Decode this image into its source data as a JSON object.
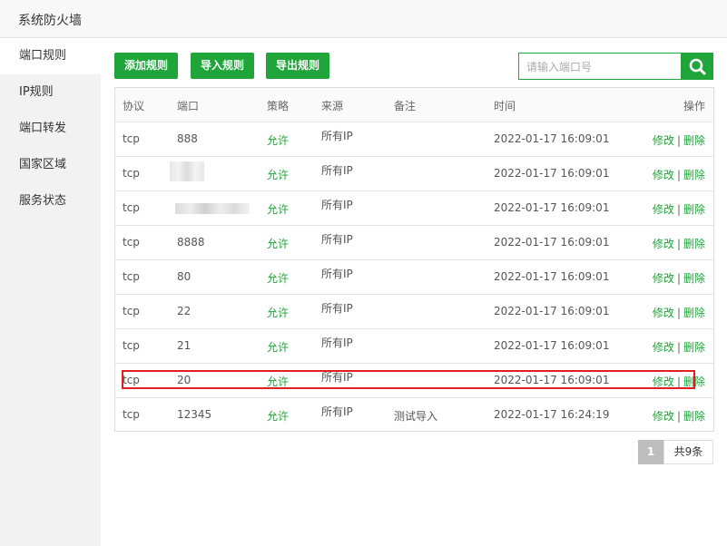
{
  "window": {
    "title": "系统防火墙"
  },
  "sidebar": {
    "items": [
      {
        "label": "端口规则"
      },
      {
        "label": "IP规则"
      },
      {
        "label": "端口转发"
      },
      {
        "label": "国家区域"
      },
      {
        "label": "服务状态"
      }
    ]
  },
  "toolbar": {
    "add_label": "添加规则",
    "import_label": "导入规则",
    "export_label": "导出规则",
    "search_placeholder": "请输入端口号",
    "search_icon": "search-icon"
  },
  "table": {
    "headers": [
      "协议",
      "端口",
      "策略",
      "来源",
      "备注",
      "时间",
      "操作"
    ],
    "rows": [
      {
        "protocol": "tcp",
        "port": "888",
        "policy": "允许",
        "source": "所有IP",
        "note": "",
        "time": "2022-01-17 16:09:01",
        "edit": "修改",
        "sep": "|",
        "delete": "删除"
      },
      {
        "protocol": "tcp",
        "port": "",
        "policy": "允许",
        "source": "所有IP",
        "note": "",
        "time": "2022-01-17 16:09:01",
        "edit": "修改",
        "sep": "|",
        "delete": "删除"
      },
      {
        "protocol": "tcp",
        "port": "",
        "policy": "允许",
        "source": "所有IP",
        "note": "",
        "time": "2022-01-17 16:09:01",
        "edit": "修改",
        "sep": "|",
        "delete": "删除"
      },
      {
        "protocol": "tcp",
        "port": "8888",
        "policy": "允许",
        "source": "所有IP",
        "note": "",
        "time": "2022-01-17 16:09:01",
        "edit": "修改",
        "sep": "|",
        "delete": "删除"
      },
      {
        "protocol": "tcp",
        "port": "80",
        "policy": "允许",
        "source": "所有IP",
        "note": "",
        "time": "2022-01-17 16:09:01",
        "edit": "修改",
        "sep": "|",
        "delete": "删除"
      },
      {
        "protocol": "tcp",
        "port": "22",
        "policy": "允许",
        "source": "所有IP",
        "note": "",
        "time": "2022-01-17 16:09:01",
        "edit": "修改",
        "sep": "|",
        "delete": "删除"
      },
      {
        "protocol": "tcp",
        "port": "21",
        "policy": "允许",
        "source": "所有IP",
        "note": "",
        "time": "2022-01-17 16:09:01",
        "edit": "修改",
        "sep": "|",
        "delete": "删除"
      },
      {
        "protocol": "tcp",
        "port": "20",
        "policy": "允许",
        "source": "所有IP",
        "note": "",
        "time": "2022-01-17 16:09:01",
        "edit": "修改",
        "sep": "|",
        "delete": "删除"
      },
      {
        "protocol": "tcp",
        "port": "12345",
        "policy": "允许",
        "source": "所有IP",
        "note": "测试导入",
        "time": "2022-01-17 16:24:19",
        "edit": "修改",
        "sep": "|",
        "delete": "删除"
      }
    ]
  },
  "pagination": {
    "current": "1",
    "total": "共9条"
  },
  "colors": {
    "accent": "#20a53a",
    "highlight": "#e02020"
  }
}
